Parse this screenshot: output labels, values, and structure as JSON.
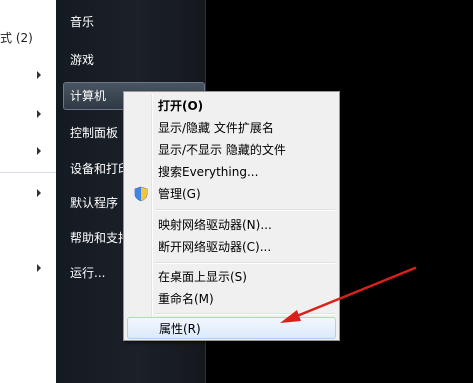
{
  "program_list": {
    "partial_item_label": "式 (2)"
  },
  "start_menu_right": {
    "items": [
      {
        "label": "音乐"
      },
      {
        "label": "游戏"
      },
      {
        "label": "计算机"
      },
      {
        "label": "控制面板"
      },
      {
        "label": "设备和打印"
      },
      {
        "label": "默认程序"
      },
      {
        "label": "帮助和支持"
      },
      {
        "label": "运行..."
      }
    ],
    "selected_item": "计算机"
  },
  "context_menu": {
    "items": [
      {
        "label": "打开(O)",
        "bold": true
      },
      {
        "label": "显示/隐藏 文件扩展名"
      },
      {
        "label": "显示/不显示 隐藏的文件"
      },
      {
        "label": "搜索Everything..."
      },
      {
        "label": "管理(G)",
        "icon": "uac-shield-icon"
      },
      {
        "label": "映射网络驱动器(N)..."
      },
      {
        "label": "断开网络驱动器(C)..."
      },
      {
        "label": "在桌面上显示(S)"
      },
      {
        "label": "重命名(M)"
      },
      {
        "label": "属性(R)",
        "highlighted": true
      }
    ]
  },
  "colors": {
    "annotation_arrow": "#d9201a",
    "menu_highlight_border": "#aecff7"
  }
}
